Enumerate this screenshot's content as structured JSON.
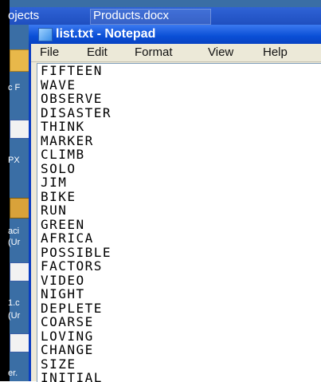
{
  "background_tabs": [
    "ojects",
    "Products.docx"
  ],
  "side_labels": [
    "c F",
    "PX",
    "aci",
    "(Ur",
    "1.c",
    "(Ur",
    "er."
  ],
  "window": {
    "title": "list.txt - Notepad",
    "menu": [
      "File",
      "Edit",
      "Format",
      "View",
      "Help"
    ]
  },
  "document": {
    "lines": [
      "FIFTEEN",
      "WAVE",
      "OBSERVE",
      "DISASTER",
      "THINK",
      "MARKER",
      "CLIMB",
      "SOLO",
      "JIM",
      "BIKE",
      "RUN",
      "GREEN",
      "AFRICA",
      "POSSIBLE",
      "FACTORS",
      "VIDEO",
      "NIGHT",
      "DEPLETE",
      "COARSE",
      "LOVING",
      "CHANGE",
      "SIZE",
      "INITIAL"
    ]
  },
  "colors": {
    "titlebar": "#0a4fd6",
    "menubar": "#ece9d8",
    "desktop": "#3a6ea5"
  }
}
